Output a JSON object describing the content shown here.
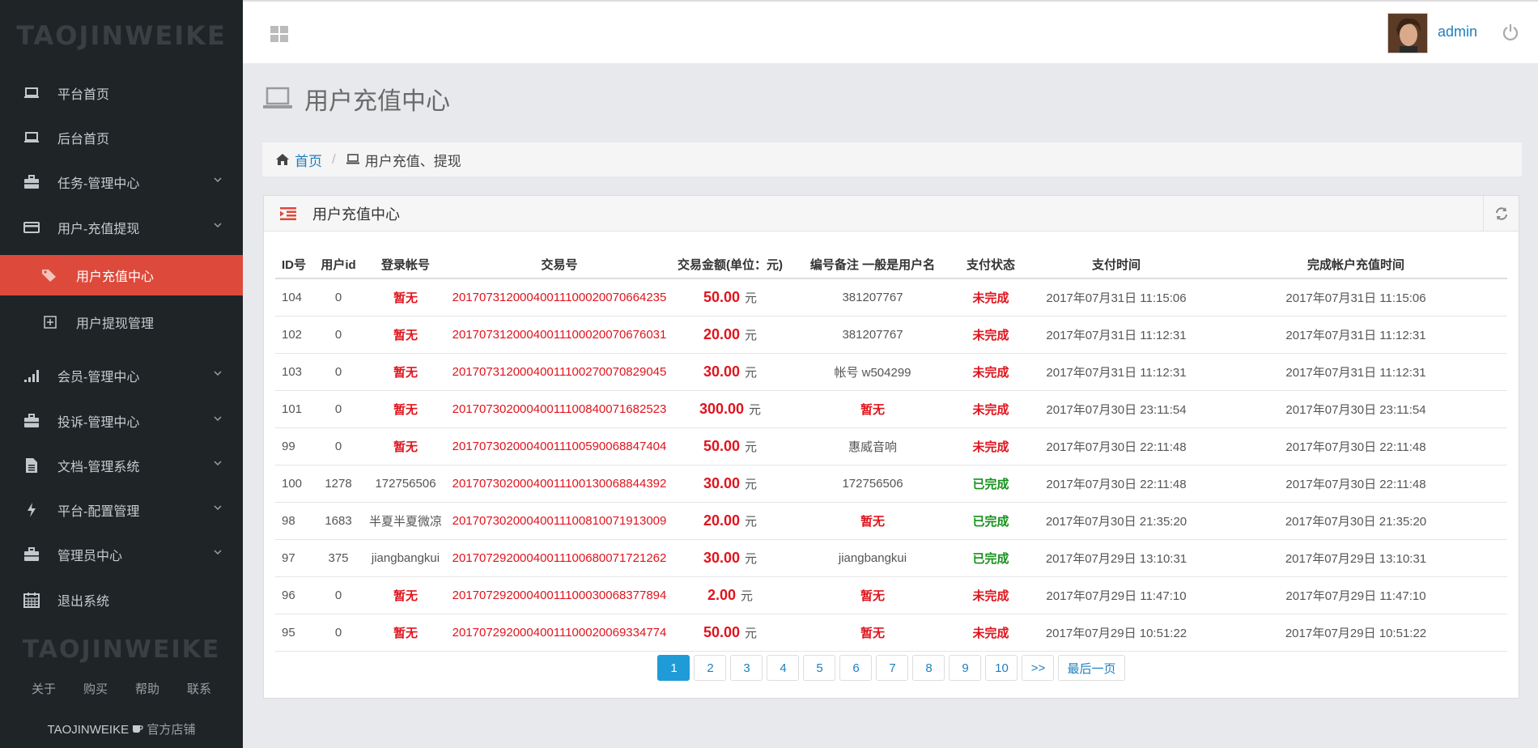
{
  "brand": "TAOJINWEIKE",
  "sidebar": {
    "items": [
      {
        "label": "平台首页",
        "icon": "laptop-icon"
      },
      {
        "label": "后台首页",
        "icon": "laptop-icon"
      },
      {
        "label": "任务-管理中心",
        "icon": "briefcase-icon"
      },
      {
        "label": "用户-充值提现",
        "icon": "credit-card-icon"
      },
      {
        "label": "用户充值中心",
        "icon": "tags-icon"
      },
      {
        "label": "用户提现管理",
        "icon": "plus-square-icon"
      },
      {
        "label": "会员-管理中心",
        "icon": "signal-icon"
      },
      {
        "label": "投诉-管理中心",
        "icon": "briefcase-icon"
      },
      {
        "label": "文档-管理系统",
        "icon": "file-icon"
      },
      {
        "label": "平台-配置管理",
        "icon": "bolt-icon"
      },
      {
        "label": "管理员中心",
        "icon": "briefcase-icon"
      },
      {
        "label": "退出系统",
        "icon": "calendar-icon"
      }
    ],
    "footer_links": [
      "关于",
      "购买",
      "帮助",
      "联系"
    ],
    "shop_brand": "TAOJINWEIKE",
    "shop_label": "官方店铺"
  },
  "topbar": {
    "username": "admin"
  },
  "page": {
    "title": "用户充值中心"
  },
  "breadcrumb": {
    "home": "首页",
    "current": "用户充值、提现"
  },
  "panel": {
    "title": "用户充值中心"
  },
  "table": {
    "headers": [
      "ID号",
      "用户id",
      "登录帐号",
      "交易号",
      "交易金额(单位：元)",
      "编号备注 一般是用户名",
      "支付状态",
      "支付时间",
      "完成帐户充值时间"
    ],
    "unit": "元",
    "rows": [
      {
        "id": "104",
        "uid": "0",
        "account": "暂无",
        "txn": "20170731200040011100020070664235",
        "amount": "50.00",
        "note": "381207767",
        "status": "未完成",
        "pay_time": "2017年07月31日 11:15:06",
        "done_time": "2017年07月31日 11:15:06"
      },
      {
        "id": "102",
        "uid": "0",
        "account": "暂无",
        "txn": "20170731200040011100020070676031",
        "amount": "20.00",
        "note": "381207767",
        "status": "未完成",
        "pay_time": "2017年07月31日 11:12:31",
        "done_time": "2017年07月31日 11:12:31"
      },
      {
        "id": "103",
        "uid": "0",
        "account": "暂无",
        "txn": "20170731200040011100270070829045",
        "amount": "30.00",
        "note": "帐号 w504299",
        "status": "未完成",
        "pay_time": "2017年07月31日 11:12:31",
        "done_time": "2017年07月31日 11:12:31"
      },
      {
        "id": "101",
        "uid": "0",
        "account": "暂无",
        "txn": "20170730200040011100840071682523",
        "amount": "300.00",
        "note": "暂无",
        "status": "未完成",
        "pay_time": "2017年07月30日 23:11:54",
        "done_time": "2017年07月30日 23:11:54"
      },
      {
        "id": "99",
        "uid": "0",
        "account": "暂无",
        "txn": "20170730200040011100590068847404",
        "amount": "50.00",
        "note": "惠威音响",
        "status": "未完成",
        "pay_time": "2017年07月30日 22:11:48",
        "done_time": "2017年07月30日 22:11:48"
      },
      {
        "id": "100",
        "uid": "1278",
        "account": "172756506",
        "txn": "20170730200040011100130068844392",
        "amount": "30.00",
        "note": "172756506",
        "status": "已完成",
        "pay_time": "2017年07月30日 22:11:48",
        "done_time": "2017年07月30日 22:11:48"
      },
      {
        "id": "98",
        "uid": "1683",
        "account": "半夏半夏微凉",
        "txn": "20170730200040011100810071913009",
        "amount": "20.00",
        "note": "暂无",
        "status": "已完成",
        "pay_time": "2017年07月30日 21:35:20",
        "done_time": "2017年07月30日 21:35:20"
      },
      {
        "id": "97",
        "uid": "375",
        "account": "jiangbangkui",
        "txn": "20170729200040011100680071721262",
        "amount": "30.00",
        "note": "jiangbangkui",
        "status": "已完成",
        "pay_time": "2017年07月29日 13:10:31",
        "done_time": "2017年07月29日 13:10:31"
      },
      {
        "id": "96",
        "uid": "0",
        "account": "暂无",
        "txn": "20170729200040011100030068377894",
        "amount": "2.00",
        "note": "暂无",
        "status": "未完成",
        "pay_time": "2017年07月29日 11:47:10",
        "done_time": "2017年07月29日 11:47:10"
      },
      {
        "id": "95",
        "uid": "0",
        "account": "暂无",
        "txn": "20170729200040011100020069334774",
        "amount": "50.00",
        "note": "暂无",
        "status": "未完成",
        "pay_time": "2017年07月29日 10:51:22",
        "done_time": "2017年07月29日 10:51:22"
      }
    ]
  },
  "pagination": {
    "pages": [
      "1",
      "2",
      "3",
      "4",
      "5",
      "6",
      "7",
      "8",
      "9",
      "10",
      ">>",
      "最后一页"
    ],
    "active": "1"
  },
  "colors": {
    "sidebar_bg": "#1f2427",
    "active_red": "#dd4a3c",
    "link_blue": "#1f7fbd",
    "status_red": "#e0141d",
    "status_green": "#16921c"
  }
}
